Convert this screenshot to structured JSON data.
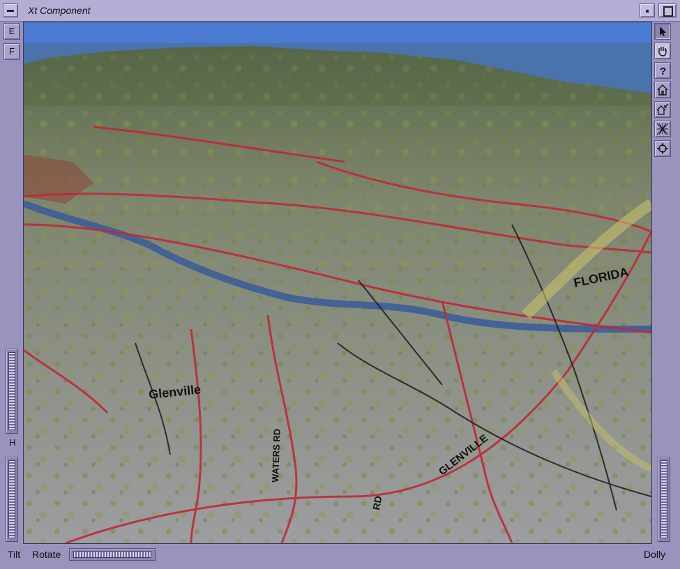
{
  "window": {
    "title": "Xt Component"
  },
  "left_panel": {
    "buttons": [
      {
        "label": "E"
      },
      {
        "label": "F"
      }
    ],
    "h_label": "H"
  },
  "bottom_bar": {
    "tilt_label": "Tilt",
    "rotate_label": "Rotate",
    "dolly_label": "Dolly"
  },
  "toolbar": {
    "tools": [
      {
        "icon": "pick-arrow-icon"
      },
      {
        "icon": "view-hand-icon"
      },
      {
        "icon": "help-icon",
        "glyph": "?"
      },
      {
        "icon": "home-icon"
      },
      {
        "icon": "set-home-icon"
      },
      {
        "icon": "view-all-icon"
      },
      {
        "icon": "seek-icon"
      }
    ]
  },
  "viewer": {
    "content": "3D terrain textured with topographic road map",
    "map_labels": [
      {
        "text": "Glenville"
      },
      {
        "text": "WATERS RD"
      },
      {
        "text": "GLENVILLE"
      },
      {
        "text": "FLORIDA"
      },
      {
        "text": "RD"
      }
    ]
  },
  "colors": {
    "frame": "#9a93bd",
    "title_bar": "#b4aed4",
    "sky": "#4a7bd1"
  }
}
